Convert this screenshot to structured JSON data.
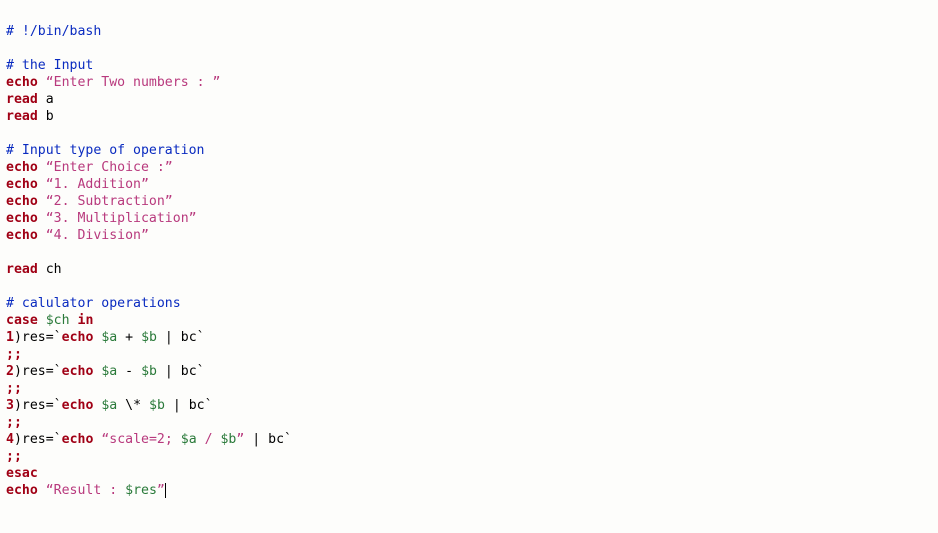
{
  "code": {
    "shebang": "# !/bin/bash",
    "sec1_comment": "# the Input",
    "echo_input_prompt_open": "“Enter Two numbers : ”",
    "read_a_kw": "read",
    "read_a_var": "a",
    "read_b_kw": "read",
    "read_b_var": "b",
    "sec2_comment": "# Input type of operation",
    "echo_choice": "“Enter Choice :”",
    "echo_1": "“1. Addition”",
    "echo_2": "“2. Subtraction”",
    "echo_3": "“3. Multiplication”",
    "echo_4": "“4. Division”",
    "read_ch_kw": "read",
    "read_ch_var": "ch",
    "sec3_comment": "# calulator operations",
    "case_kw": "case",
    "case_var": "$ch",
    "in_kw": "in",
    "label1": "1",
    "label2": "2",
    "label3": "3",
    "label4": "4",
    "paren": ")",
    "res_eq": "res=",
    "echo_kw": "echo",
    "bt_open": "`",
    "bt_close": "`",
    "var_a": "$a",
    "var_b": "$b",
    "pipe_bc": " | bc",
    "plus": " + ",
    "minus": " - ",
    "mul": " \\* ",
    "div_open": "“scale=2; ",
    "div_mid": " / ",
    "div_close": "”",
    "dsemis": ";;",
    "esac": "esac",
    "result_open": "“Result : ",
    "result_var": "$res",
    "result_close": "”"
  },
  "chart_data": {
    "type": "table",
    "title": "Bash calculator script",
    "lines": [
      "# !/bin/bash",
      "",
      "# the Input",
      "echo “Enter Two numbers : ”",
      "read a",
      "read b",
      "",
      "# Input type of operation",
      "echo “Enter Choice :”",
      "echo “1. Addition”",
      "echo “2. Subtraction”",
      "echo “3. Multiplication”",
      "echo “4. Division”",
      "",
      "read ch",
      "",
      "# calulator operations",
      "case $ch in",
      "1)res=`echo $a + $b | bc`",
      ";;",
      "2)res=`echo $a - $b | bc`",
      ";;",
      "3)res=`echo $a \\* $b | bc`",
      ";;",
      "4)res=`echo “scale=2; $a / $b” | bc`",
      ";;",
      "esac",
      "echo “Result : $res”"
    ]
  }
}
